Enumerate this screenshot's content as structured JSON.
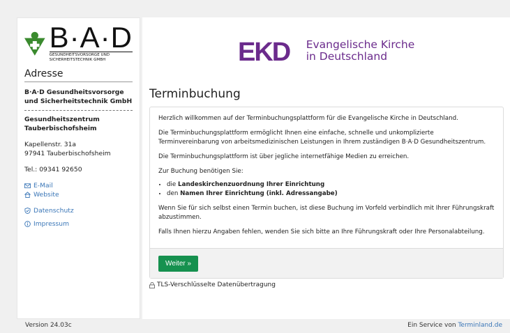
{
  "colors": {
    "accent_green": "#16914f",
    "ekd_purple": "#6b2b8c",
    "bad_green": "#3a8a2e",
    "link_blue": "#3a76b7"
  },
  "sidebar": {
    "logo_text": "B·A·D",
    "logo_sub1": "GESUNDHEITSVORSORGE UND",
    "logo_sub2": "SICHERHEITSTECHNIK GMBH",
    "title": "Adresse",
    "company_line1": "B·A·D Gesundheitsvorsorge",
    "company_line2": "und Sicherheitstechnik GmbH",
    "center_line1": "Gesundheitszentrum",
    "center_line2": "Tauberbischofsheim",
    "street": "Kapellenstr. 31a",
    "city": "97941 Tauberbischofsheim",
    "phone": "Tel.: 09341 92650",
    "email_label": "E-Mail",
    "website_label": "Website",
    "privacy_label": "Datenschutz",
    "imprint_label": "Impressum"
  },
  "main": {
    "ekd_logo_text": "EKD",
    "ekd_name_line1": "Evangelische Kirche",
    "ekd_name_line2": "in Deutschland",
    "title": "Terminbuchung",
    "p1": "Herzlich willkommen auf der Terminbuchungsplattform für die Evangelische Kirche in Deutschland.",
    "p2": "Die Terminbuchungsplattform ermöglicht Ihnen eine einfache, schnelle und unkomplizierte Terminvereinbarung von arbeitsmedizinischen Leistungen in Ihrem zuständigen B·A·D Gesundheitszentrum.",
    "p3": "Die Terminbuchungsplattform ist über jegliche internetfähige Medien zu erreichen.",
    "p4": "Zur Buchung benötigen Sie:",
    "li1_prefix": "die ",
    "li1_bold": "Landeskirchenzuordnung Ihrer Einrichtung",
    "li2_prefix": "den ",
    "li2_bold": "Namen Ihrer Einrichtung (inkl. Adressangabe)",
    "p5": "Wenn Sie für sich selbst einen Termin buchen, ist diese Buchung im Vorfeld verbindlich mit Ihrer Führungskraft abzustimmen.",
    "p6": "Falls Ihnen hierzu Angaben fehlen, wenden Sie sich bitte an Ihre Führungskraft oder Ihre Personalabteilung.",
    "next_button": "Weiter »",
    "tls_text": "TLS-Verschlüsselte Datenübertragung"
  },
  "footer": {
    "version": "Version 24.03c",
    "service_prefix": "Ein Service von ",
    "service_link": "Terminland.de"
  }
}
